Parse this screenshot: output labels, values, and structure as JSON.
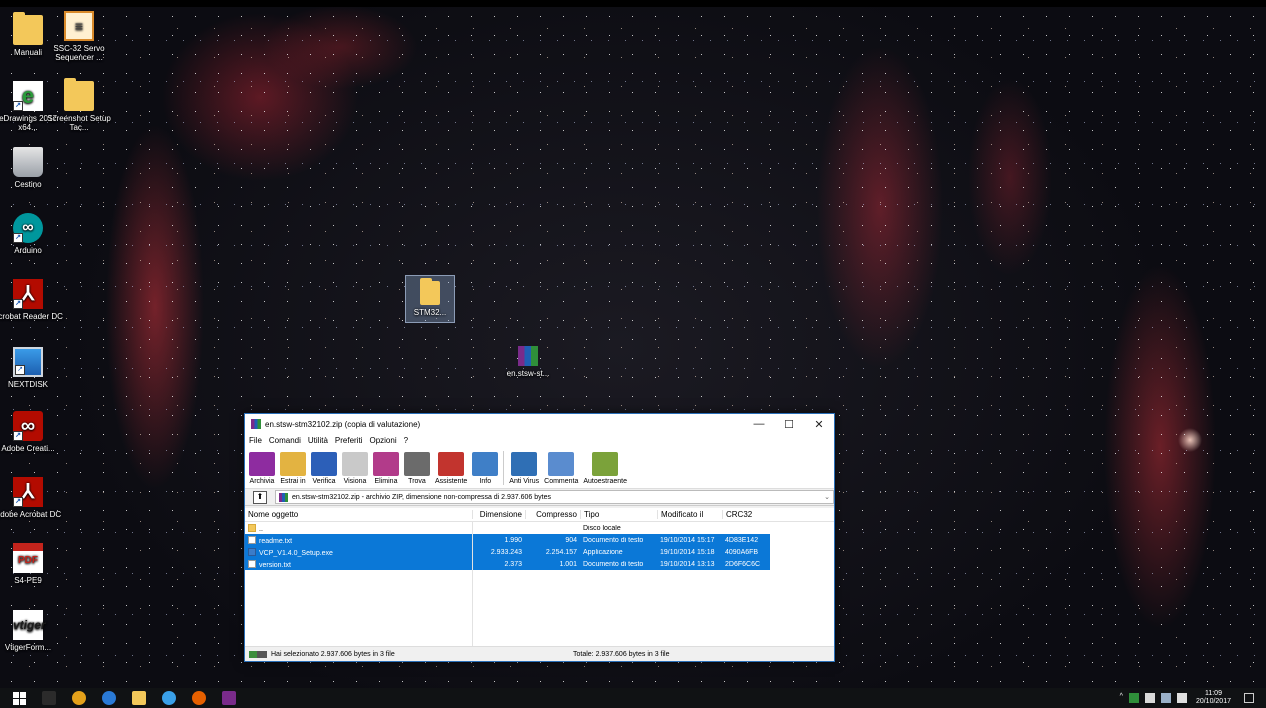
{
  "desktop": {
    "icons": [
      {
        "label": "Manuali"
      },
      {
        "label": "SSC-32 Servo Sequencer ..."
      },
      {
        "label": "eDrawings 2017 x64..."
      },
      {
        "label": "Screenshot Setup Tac..."
      },
      {
        "label": "Cestino"
      },
      {
        "label": "Arduino"
      },
      {
        "label": "Acrobat Reader DC"
      },
      {
        "label": "NEXTDISK"
      },
      {
        "label": "Adobe Creati..."
      },
      {
        "label": "Adobe Acrobat DC"
      },
      {
        "label": "S4-PE9"
      },
      {
        "label": "VtigerForm..."
      },
      {
        "label": "STM32..."
      },
      {
        "label": "en.stsw-st..."
      }
    ],
    "edrawings_badge": "2017",
    "pdf_badge": "PDF",
    "vtiger_text": "vtiger"
  },
  "window": {
    "title": "en.stsw-stm32102.zip (copia di valutazione)",
    "controls": {
      "minimize": "—",
      "maximize": "☐",
      "close": "✕"
    },
    "menu": [
      "File",
      "Comandi",
      "Utilità",
      "Preferiti",
      "Opzioni",
      "?"
    ],
    "toolbar": [
      {
        "label": "Archivia",
        "color": "#8e2ca0"
      },
      {
        "label": "Estrai in",
        "color": "#e3b341"
      },
      {
        "label": "Verifica",
        "color": "#2c5fb8"
      },
      {
        "label": "Visiona",
        "color": "#c9c9c9"
      },
      {
        "label": "Elimina",
        "color": "#b23b8a"
      },
      {
        "label": "Trova",
        "color": "#6b6b6b"
      },
      {
        "label": "Assistente",
        "color": "#c2342e"
      },
      {
        "label": "Info",
        "color": "#3f7fc7"
      },
      {
        "label": "Anti Virus",
        "color": "#2f6fb5"
      },
      {
        "label": "Commenta",
        "color": "#5a8ccf"
      },
      {
        "label": "Autoestraente",
        "color": "#7ba23a"
      }
    ],
    "address": "en.stsw-stm32102.zip - archivio ZIP, dimensione non-compressa di 2.937.606 bytes",
    "up_button": "⬆",
    "columns": [
      "Nome oggetto",
      "Dimensione",
      "Compresso",
      "Tipo",
      "Modificato il",
      "CRC32"
    ],
    "rows": [
      {
        "name": "..",
        "size": "",
        "packed": "",
        "type": "Disco locale",
        "modified": "",
        "crc": "",
        "icon": "folder",
        "selected": false
      },
      {
        "name": "readme.txt",
        "size": "1.990",
        "packed": "904",
        "type": "Documento di testo",
        "modified": "19/10/2014 15:17",
        "crc": "4D83E142",
        "icon": "txt",
        "selected": true
      },
      {
        "name": "VCP_V1.4.0_Setup.exe",
        "size": "2.933.243",
        "packed": "2.254.157",
        "type": "Applicazione",
        "modified": "19/10/2014 15:18",
        "crc": "4090A6FB",
        "icon": "exe",
        "selected": true
      },
      {
        "name": "version.txt",
        "size": "2.373",
        "packed": "1.001",
        "type": "Documento di testo",
        "modified": "19/10/2014 13:13",
        "crc": "2D6F6C6C",
        "icon": "txt",
        "selected": true
      }
    ],
    "status_left": "Hai selezionato 2.937.606 bytes in 3 file",
    "status_right": "Totale: 2.937.606 bytes in 3 file"
  },
  "taskbar": {
    "apps": [
      {
        "name": "task-view-icon",
        "color": "#2b2b2b"
      },
      {
        "name": "chrome-icon",
        "color": "#e4a11b"
      },
      {
        "name": "edge-icon",
        "color": "#2a7ad6"
      },
      {
        "name": "file-explorer-icon",
        "color": "#f3c85a"
      },
      {
        "name": "network-icon",
        "color": "#3aa0e8"
      },
      {
        "name": "firefox-icon",
        "color": "#e66000"
      },
      {
        "name": "winrar-icon",
        "color": "#7a2b8a"
      }
    ],
    "clock_time": "11:09",
    "clock_date": "20/10/2017"
  }
}
